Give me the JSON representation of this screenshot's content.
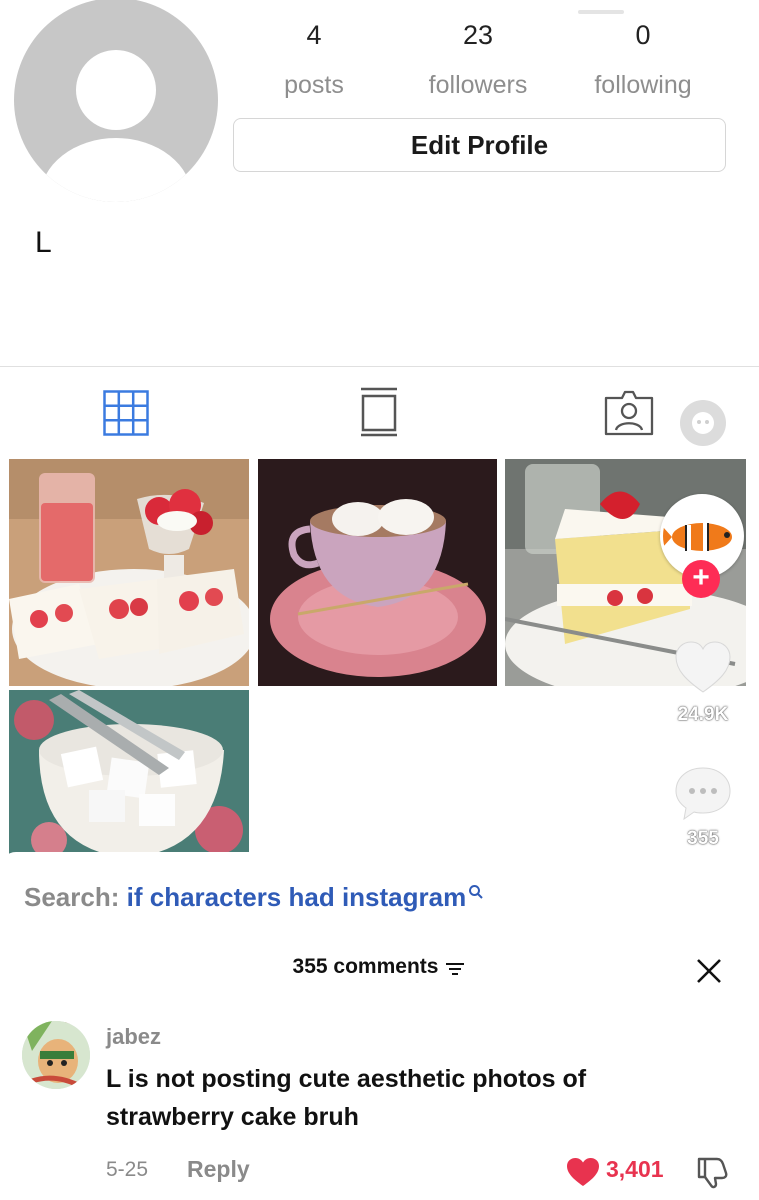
{
  "profile": {
    "stats": [
      {
        "value": "4",
        "label": "posts"
      },
      {
        "value": "23",
        "label": "followers"
      },
      {
        "value": "0",
        "label": "following"
      }
    ],
    "edit_button": "Edit Profile",
    "username": "L",
    "avatar_icon": "default-avatar-icon"
  },
  "tabs": [
    {
      "icon": "grid-icon",
      "active": true
    },
    {
      "icon": "reels-icon",
      "active": false
    },
    {
      "icon": "tagged-icon",
      "active": false
    }
  ],
  "overlay": {
    "likes": "24.9K",
    "comments": "355",
    "accent": "#fe2c55"
  },
  "search": {
    "prefix": "Search:",
    "query": "if characters had instagram"
  },
  "comments_sheet": {
    "title": "355 comments",
    "comment": {
      "user": "jabez",
      "text": "L is not posting cute aesthetic photos of strawberry cake bruh",
      "date": "5-25",
      "reply": "Reply",
      "likes": "3,401",
      "like_color": "#e8334f"
    }
  }
}
